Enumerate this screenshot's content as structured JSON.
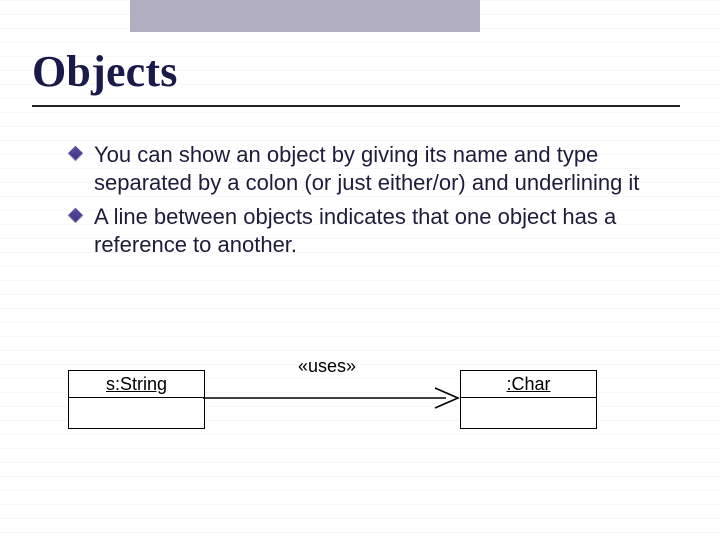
{
  "title": "Objects",
  "bullets": [
    "You can show an object by giving its name and type separated by a colon (or just either/or) and underlining it",
    "A line between objects indicates that one object has a reference to another."
  ],
  "diagram": {
    "left_object": "s:String",
    "right_object": ":Char",
    "relation_label": "«uses»"
  }
}
